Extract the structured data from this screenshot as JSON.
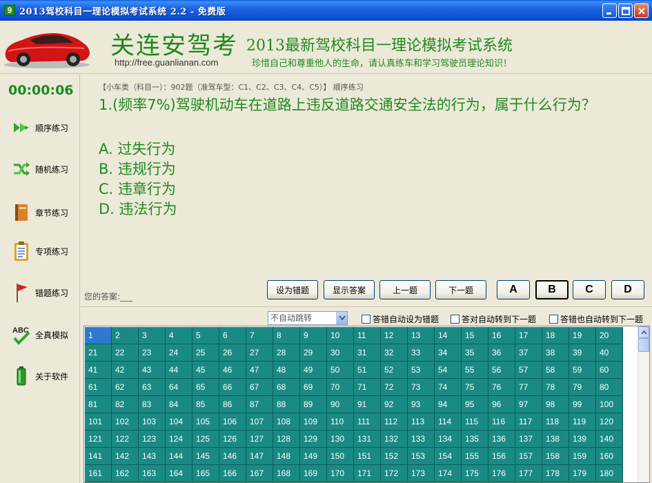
{
  "window": {
    "title": "2013驾校科目一理论模拟考试系统 2.2 - 免费版",
    "app_icon_text": "9"
  },
  "header": {
    "brand": "关连安驾考",
    "website": "http://free.guanlianan.com",
    "system_title": "2013最新驾校科目一理论模拟考试系统",
    "slogan": "珍惜自己和尊重他人的生命，请认真练车和学习驾驶员理论知识！"
  },
  "sidebar": {
    "timer": "00:00:06",
    "items": [
      {
        "label": "顺序练习",
        "icon": "arrows-right-icon"
      },
      {
        "label": "随机练习",
        "icon": "shuffle-icon"
      },
      {
        "label": "章节练习",
        "icon": "book-icon"
      },
      {
        "label": "专项练习",
        "icon": "clipboard-icon"
      },
      {
        "label": "错题练习",
        "icon": "flag-icon"
      },
      {
        "label": "全真模拟",
        "icon": "abc-check-icon"
      },
      {
        "label": "关于软件",
        "icon": "battery-icon"
      }
    ]
  },
  "question": {
    "meta": "【小车类（科目一）：902题（准驾车型：C1、C2、C3、C4、C5）】 顺序练习",
    "text": "1.(频率7%)驾驶机动车在道路上违反道路交通安全法的行为，属于什么行为？",
    "options": [
      "A. 过失行为",
      "B. 违规行为",
      "C. 违章行为",
      "D. 违法行为"
    ],
    "your_answer_label": "您的答案:___"
  },
  "actions": {
    "mark_wrong": "设为错题",
    "show_answer": "显示答案",
    "prev": "上一题",
    "next": "下一题",
    "answer_buttons": [
      "A",
      "B",
      "C",
      "D"
    ],
    "selected_answer": "B"
  },
  "options_bar": {
    "jump_select_value": "不自动跳转",
    "check_wrong_to_mark": "答错自动设为错题",
    "check_right_next": "答对自动转到下一题",
    "check_wrong_next": "答错也自动转到下一题"
  },
  "grid": {
    "current": 1,
    "visible_max": 180
  },
  "colors": {
    "accent_green": "#1f8a1f",
    "grid_teal": "#1a8a84",
    "grid_current": "#2e7ad0"
  }
}
